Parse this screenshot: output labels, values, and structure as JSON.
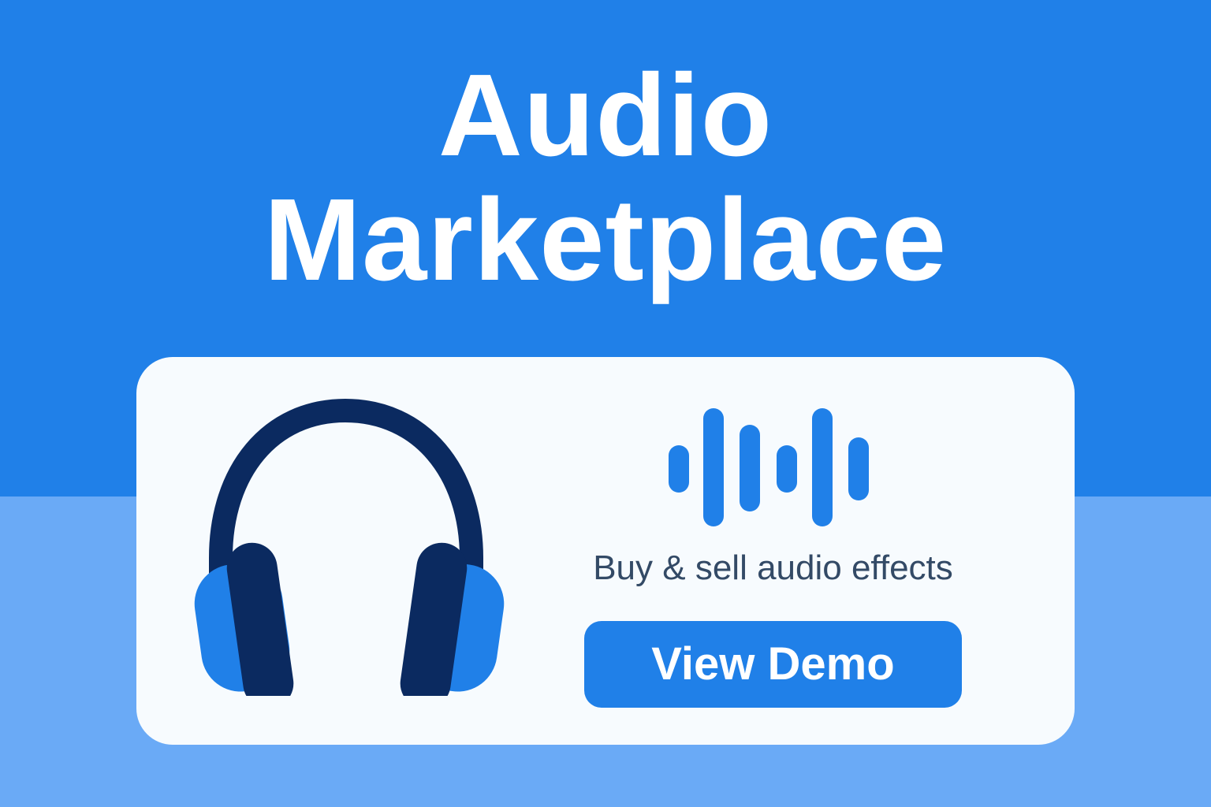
{
  "header": {
    "title_line1": "Audio",
    "title_line2": "Marketplace"
  },
  "card": {
    "tagline": "Buy & sell audio effects",
    "cta_label": "View Demo"
  },
  "icons": {
    "headphones": "headphones-icon",
    "waveform": "sound-wave-icon"
  },
  "colors": {
    "primary": "#2080e8",
    "light": "#6aaaf6",
    "dark": "#0b2a60",
    "text": "#334a66",
    "card": "#f7fbfe"
  }
}
